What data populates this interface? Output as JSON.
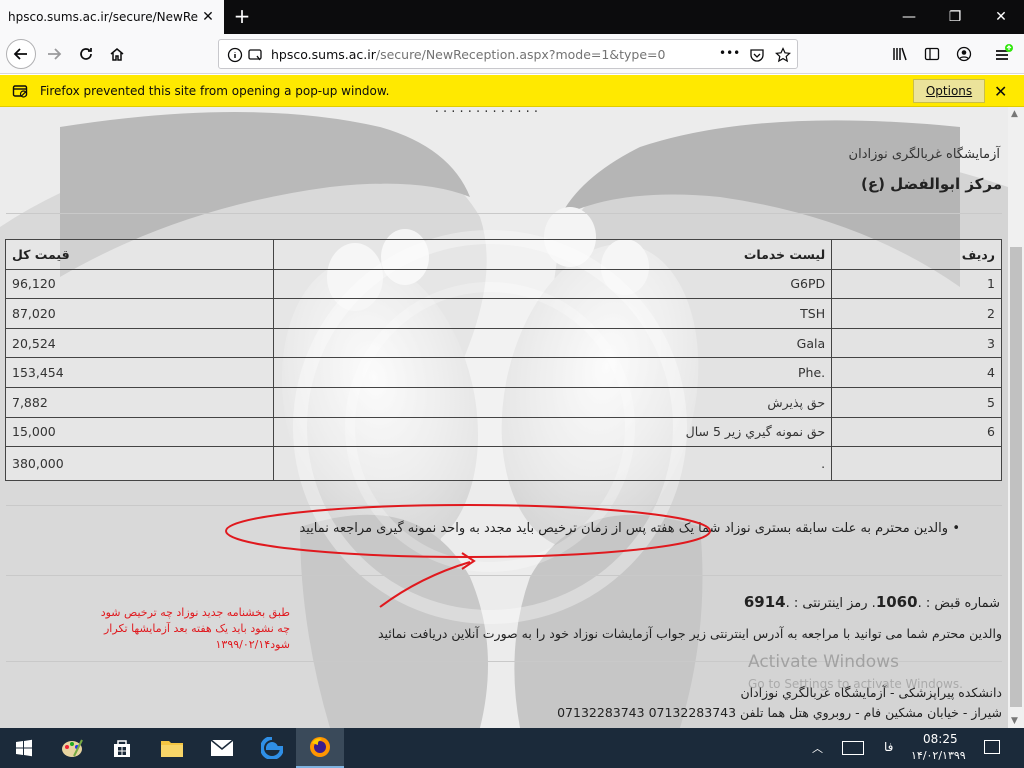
{
  "browser": {
    "tab_title": "hpsco.sums.ac.ir/secure/NewRecep",
    "url_domain": "hpsco.sums.ac.ir",
    "url_path": "/secure/NewReception.aspx?mode=1&type=0",
    "url_dots": "•••",
    "notification_text": "Firefox prevented this site from opening a pop-up window.",
    "notification_options": "Options"
  },
  "page": {
    "lab_label": "آزمایشگاه غربالگری نوزادان",
    "center_name": "مرکز ابوالفضل (ع)",
    "table": {
      "headers": {
        "row": "ردیف",
        "service": "لیست خدمات",
        "price": "قیمت کل"
      },
      "rows": [
        {
          "row": "1",
          "service": "G6PD",
          "price": "96,120"
        },
        {
          "row": "2",
          "service": "TSH",
          "price": "87,020"
        },
        {
          "row": "3",
          "service": "Gala",
          "price": "20,524"
        },
        {
          "row": "4",
          "service": ".Phe",
          "price": "153,454"
        },
        {
          "row": "5",
          "service": "حق پذیرش",
          "price": "7,882"
        },
        {
          "row": "6",
          "service": "حق نمونه گيري زير 5 سال",
          "price": "15,000"
        }
      ],
      "total_row": {
        "row": "",
        "service": ".",
        "price": "380,000"
      }
    },
    "bullet_note": "والدین محترم به علت سابقه بستری نوزاد شما یک هفته پس از زمان ترخیص باید مجدد به واحد نمونه گیری مراجعه نمایید",
    "receipt": {
      "receipt_label": "شماره قبض : .",
      "receipt_number": "1060",
      "password_label": ". رمز اینترنتی : .",
      "password_number": "6914"
    },
    "online_note": "والدین محترم شما می توانید با مراجعه به آدرس اینترنتی زیر جواب آزمایشات نوزاد خود را به صورت آنلاین دریافت نمائید",
    "footer_line1": "دانشکده پیراپزشکی - آزمایشگاه غربالگري نوزادان",
    "footer_line2": "شیراز - خیابان مشکین فام - روبروي هتل هما تلفن 07132283743 07132283743",
    "annotation": "طبق بخشنامه جدید نوزاد چه ترخیص شود چه نشود باید یک هفته بعد آزمایشها تکرار شود۱۳۹۹/۰۲/۱۴",
    "watermark_line1": "Activate Windows",
    "watermark_line2": "Go to Settings to activate Windows."
  },
  "taskbar": {
    "time": "08:25",
    "date": "۱۴/۰۲/۱۳۹۹",
    "lang": "فا"
  },
  "colors": {
    "notification_bg": "#ffe900",
    "annotation_red": "#e0191e",
    "taskbar_bg": "#1b2a3a"
  }
}
